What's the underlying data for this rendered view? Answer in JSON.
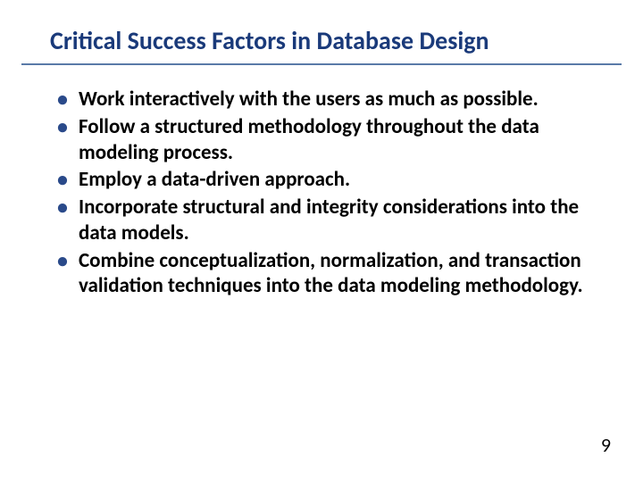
{
  "title": "Critical Success Factors in Database Design",
  "bullets": [
    "Work interactively with the users as much as possible.",
    "Follow a structured methodology throughout the data modeling process.",
    "Employ a data-driven approach.",
    "Incorporate structural and integrity considerations into the data models.",
    "Combine conceptualization, normalization, and transaction validation techniques into the data modeling methodology."
  ],
  "page_number": "9"
}
